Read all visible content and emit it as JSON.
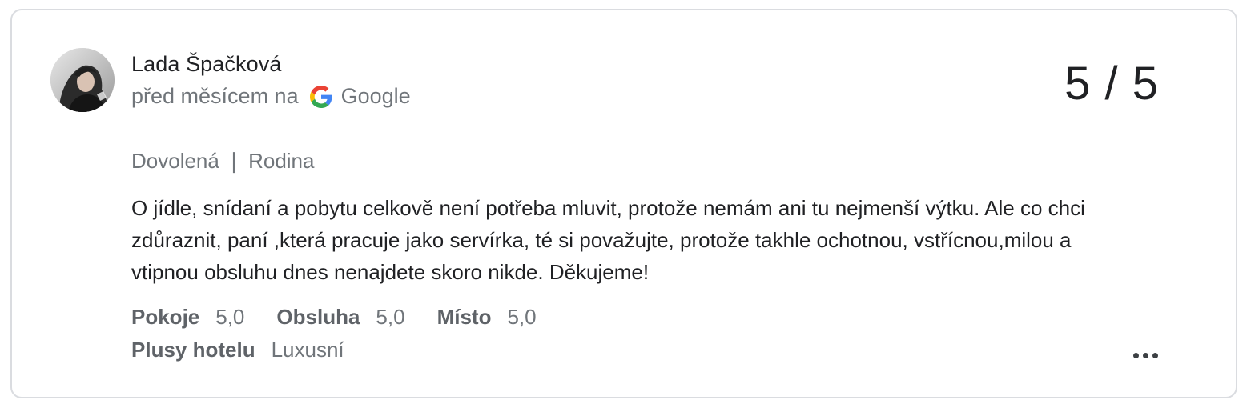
{
  "review": {
    "reviewer_name": "Lada Špačková",
    "time_ago": "před měsícem na",
    "source_icon": "google-g-icon",
    "source": "Google",
    "rating": "5 / 5",
    "trip_type": "Dovolená ❘ Rodina",
    "text": "O jídle, snídaní a pobytu celkově není potřeba mluvit, protože nemám ani tu nejmenší výtku. Ale co chci zdůraznit, paní ,která pracuje jako servírka, té si považujte, protože takhle ochotnou, vstřícnou,milou a vtipnou obsluhu dnes nenajdete skoro nikde. Děkujeme!",
    "subratings": [
      {
        "label": "Pokoje",
        "value": "5,0"
      },
      {
        "label": "Obsluha",
        "value": "5,0"
      },
      {
        "label": "Místo",
        "value": "5,0"
      }
    ],
    "highlights": {
      "label": "Plusy hotelu",
      "value": "Luxusní"
    },
    "more_icon": "more-horizontal-icon"
  },
  "colors": {
    "border": "#dadce0",
    "text_primary": "#202124",
    "text_secondary": "#70757a",
    "label": "#5f6368"
  }
}
